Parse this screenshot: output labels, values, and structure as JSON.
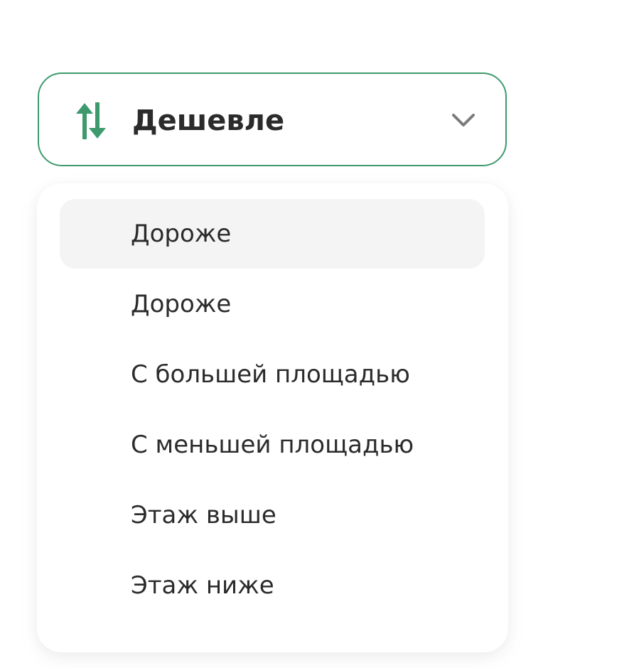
{
  "sort": {
    "selected_label": "Дешевле",
    "icon": "sort-arrows-icon",
    "chevron_icon": "chevron-down-icon",
    "accent_color": "#3e9a6d"
  },
  "options": [
    {
      "label": "Дороже",
      "highlighted": true
    },
    {
      "label": "Дороже",
      "highlighted": false
    },
    {
      "label": "С большей площадью",
      "highlighted": false
    },
    {
      "label": "С меньшей площадью",
      "highlighted": false
    },
    {
      "label": "Этаж выше",
      "highlighted": false
    },
    {
      "label": "Этаж ниже",
      "highlighted": false
    }
  ]
}
